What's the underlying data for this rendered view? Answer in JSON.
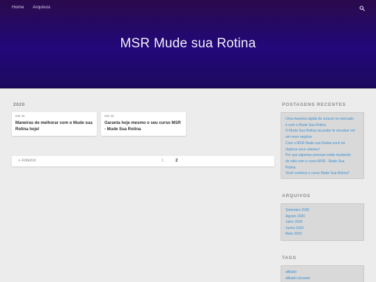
{
  "nav": {
    "home": "Home",
    "archives": "Arquivos"
  },
  "site_title": "MSR Mude sua Rotina",
  "year_heading": "2020",
  "posts": [
    {
      "date": "Mai 26",
      "title": "Maneiras de melhorar com o Mude sua Rotina hoje!"
    },
    {
      "date": "Mai 26",
      "title": "Garanta hoje mesmo o seu curso MSR - Mude Sua Rotina"
    }
  ],
  "pagination": {
    "prev": "« Anterior",
    "page1": "1",
    "page2": "2"
  },
  "sidebar": {
    "recent_title": "POSTAGENS RECENTES",
    "recent": [
      "Uma maneira rápida de crescer no mercado",
      "é com o Mude Sua Rotina",
      "O Mude Sua Rotina vai poder te encaixar em",
      "um novo negócio",
      "Com o MSR Mude sua Rotina você irá",
      "duplicar seus clientes!",
      "Por que algumas pessoas estão mudando",
      "de vida com o curso MSR - Mude Sua",
      "Rotina",
      "Você conhece o curso Mude Sua Rotina?"
    ],
    "archives_title": "ARQUIVOS",
    "archives": [
      "Setembro 2020",
      "Agosto 2020",
      "Julho 2020",
      "Junho 2020",
      "Maio 2020"
    ],
    "tags_title": "TAGS",
    "tags": [
      "afiliado",
      "afiliado iniciante"
    ]
  },
  "colors": {
    "hero": "#22087a",
    "link": "#3d8fd0",
    "background": "#ececec"
  }
}
